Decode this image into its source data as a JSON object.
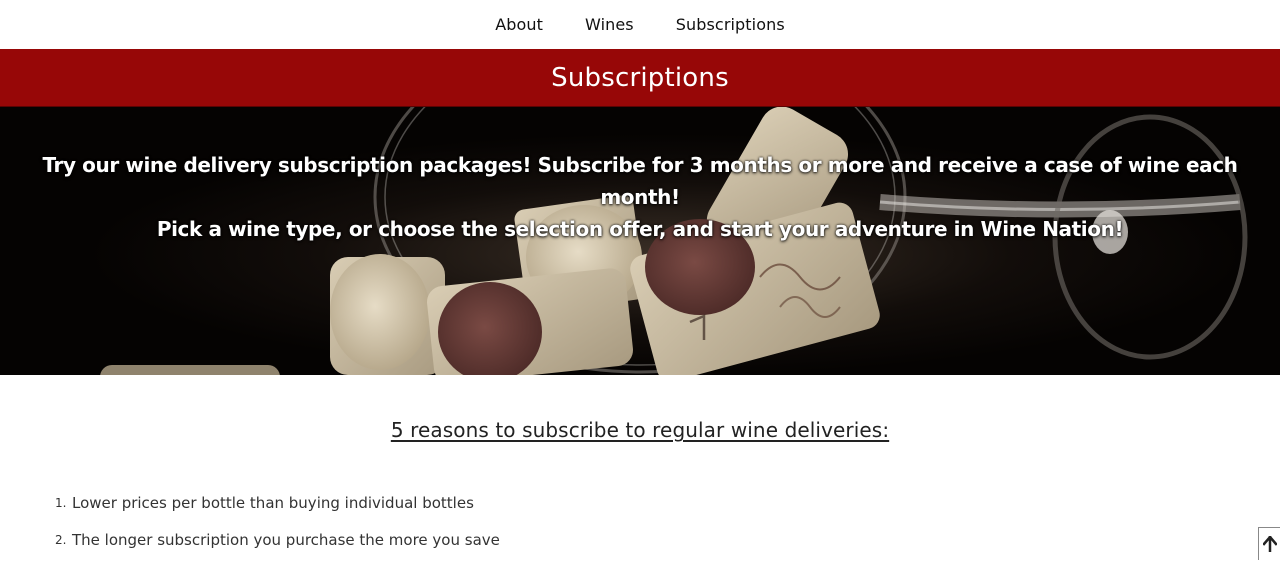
{
  "nav": {
    "items": [
      {
        "label": "About"
      },
      {
        "label": "Wines"
      },
      {
        "label": "Subscriptions"
      }
    ]
  },
  "header": {
    "title": "Subscriptions"
  },
  "hero": {
    "line1": "Try our wine delivery subscription packages! Subscribe for 3 months or more and receive a case of wine each month!",
    "line2": "Pick a wine type, or choose the selection offer, and start your adventure in Wine Nation!",
    "image": "wine-corks-in-glass"
  },
  "reasons": {
    "heading": "5 reasons to subscribe to regular wine deliveries:",
    "items": [
      "Lower prices per bottle than buying individual bottles",
      "The longer subscription you purchase the more you save"
    ]
  },
  "colors": {
    "header_bg": "#970707",
    "hero_bg": "#060403",
    "text": "#333333"
  },
  "icons": {
    "scroll_top": "arrow-up-icon"
  }
}
